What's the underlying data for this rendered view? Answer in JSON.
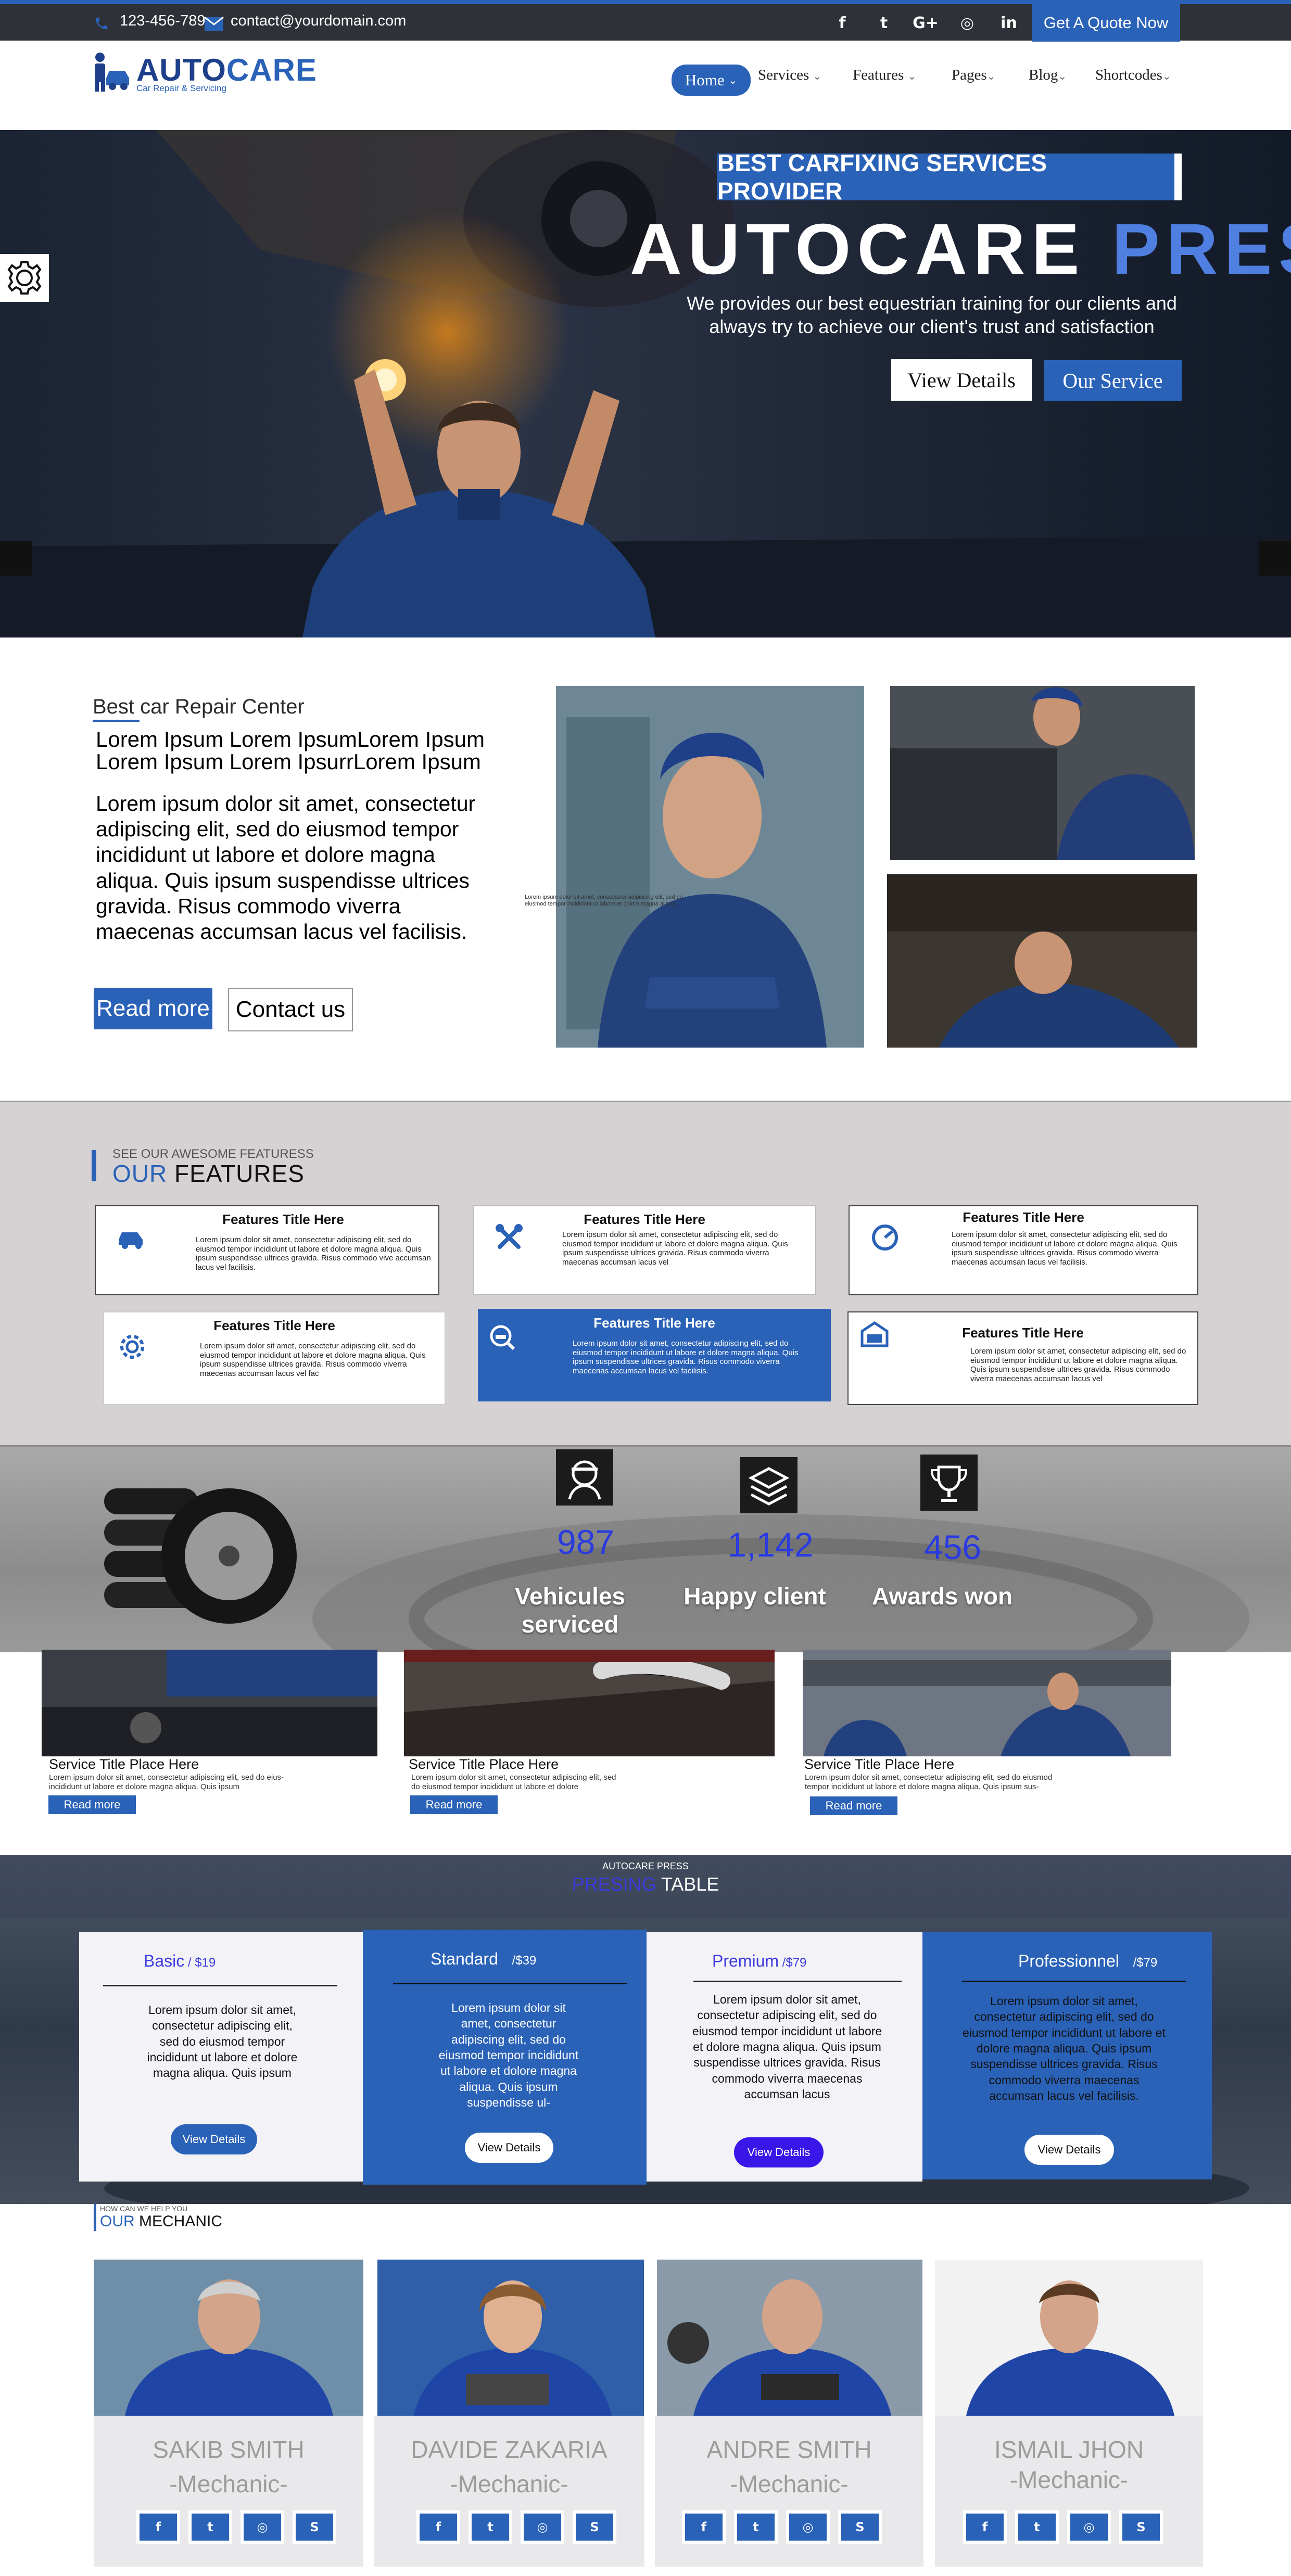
{
  "topbar": {
    "phone": "123-456-789",
    "email": "contact@yourdomain.com",
    "social": [
      "f",
      "t",
      "G+",
      "◎",
      "in"
    ],
    "quote_button": "Get  A Quote Now"
  },
  "header": {
    "logo_auto": "AUTO",
    "logo_care": "CARE",
    "logo_tagline": "Car Repair & Servicing",
    "nav": [
      {
        "label": "Home",
        "active": true
      },
      {
        "label": "Services"
      },
      {
        "label": "Features"
      },
      {
        "label": "Pages"
      },
      {
        "label": "Blog"
      },
      {
        "label": "Shortcodes"
      }
    ]
  },
  "hero": {
    "badge": "BEST CARFIXING SERVICES PROVIDER",
    "title_main": "AUTOCARE ",
    "title_accent": "PRESS",
    "description": "We provides our best equestrian training for our clients and always try to achieve our client's trust and satisfaction",
    "view_button": "View Details",
    "service_button": "Our Service"
  },
  "about": {
    "eyebrow": "Best car Repair Center",
    "heading": "Lorem Ipsum Lorem IpsumLorem Ipsum Lorem Ipsum Lorem IpsurrLorem Ipsum",
    "body": "Lorem ipsum dolor sit amet, consectetur adipiscing elit, sed do eiusmod tempor incididunt ut labore et dolore magna aliqua. Quis ipsum suspendisse ultrices gravida. Risus commodo viverra maecenas accumsan lacus vel facilisis.",
    "read_more": "Read more",
    "contact": "Contact us",
    "small_text": "Lorem ipsum dolor sit amet, consectetur adipiscing elit, sed do eiusmod tempor incididunt ut labore et dolore magna aliqua."
  },
  "features": {
    "eyebrow": "SEE OUR AWESOME FEATURESS",
    "title_accent": "OUR",
    "title_rest": " FEATURES",
    "cards": [
      {
        "title": "Features Title Here",
        "text": "Lorem ipsum dolor sit amet, consectetur adipiscing elit, sed do eiusmod tempor incididunt ut labore et dolore magna aliqua. Quis ipsum suspendisse ultrices gravida. Risus commodo vive accumsan lacus vel facilisis.",
        "icon": "car-icon"
      },
      {
        "title": "Features Title Here",
        "text": "Lorem ipsum dolor sit amet, consectetur adipiscing elit, sed do eiusmod tempor incididunt ut labore et dolore magna aliqua. Quis ipsum suspendisse ultrices gravida. Risus commodo viverra maecenas accumsan lacus vel",
        "icon": "tools-icon"
      },
      {
        "title": "Features Title Here",
        "text": "Lorem ipsum dolor sit amet, consectetur adipiscing elit, sed do eiusmod tempor incididunt ut labore et dolore magna aliqua. Quis ipsum suspendisse ultrices gravida. Risus commodo viverra maecenas accumsan lacus vel facilisis.",
        "icon": "gauge-icon"
      },
      {
        "title": "Features Title Here",
        "text": "Lorem ipsum dolor sit amet, consectetur adipiscing elit, sed do eiusmod tempor incididunt ut labore et dolore magna aliqua. Quis ipsum suspendisse ultrices gravida. Risus commodo viverra maecenas accumsan lacus vel fac",
        "icon": "gear-icon"
      },
      {
        "title": "Features Title Here",
        "text": "Lorem ipsum dolor sit amet, consectetur adipiscing elit, sed do eiusmod tempor incididunt ut labore et dolore magna aliqua. Quis ipsum suspendisse ultrices gravida. Risus commodo viverra maecenas accumsan lacus vel facilisis.",
        "icon": "search-car-icon",
        "active": true
      },
      {
        "title": "Features Title Here",
        "text": "Lorem ipsum dolor sit amet, consectetur adipiscing elit, sed do eiusmod tempor incididunt ut labore et dolore magna aliqua. Quis ipsum suspendisse ultrices gravida. Risus commodo viverra maecenas accumsan lacus vel",
        "icon": "garage-icon"
      }
    ]
  },
  "stats": [
    {
      "number": "987",
      "label": "Vehicules serviced",
      "icon": "mechanic-icon"
    },
    {
      "number": "1,142",
      "label": "Happy client",
      "icon": "layers-icon"
    },
    {
      "number": "456",
      "label": "Awards won",
      "icon": "trophy-icon"
    }
  ],
  "services": [
    {
      "title": "Service Title Place Here",
      "text": "Lorem ipsum dolor sit amet, consectetur adipiscing elit, sed do eius- incididunt ut labore et dolore magna aliqua. Quis ipsum",
      "button": "Read more"
    },
    {
      "title": "Service Title Place Here",
      "text": "Lorem ipsum dolor sit amet, consectetur adipiscing elit, sed do eiusmod tempor incididunt ut labore et dolore",
      "button": "Read more"
    },
    {
      "title": "Service Title Place Here",
      "text": "Lorem ipsum dolor sit amet, consectetur adipiscing elit, sed do eiusmod tempor incididunt ut labore et dolore magna aliqua. Quis ipsum sus-",
      "button": "Read more"
    }
  ],
  "pricing": {
    "eyebrow": "AUTOCARE PRESS",
    "title_accent": "PRESING",
    "title_rest": " TABLE",
    "plans": [
      {
        "name": "Basic",
        "price": " / $19",
        "text": "Lorem ipsum dolor sit amet, consectetur adipiscing elit, sed do eiusmod tempor incididunt ut labore et dolore magna aliqua. Quis ipsum",
        "button": "View Details"
      },
      {
        "name": "Standard",
        "price": "    /$39",
        "text": "Lorem ipsum dolor sit amet, consectetur adipiscing elit, sed do eiusmod tempor incididunt ut labore et dolore magna aliqua. Quis ipsum suspendisse ul-",
        "button": "View Details"
      },
      {
        "name": "Premium",
        "price": " /$79",
        "text": "Lorem ipsum dolor sit amet, consectetur adipiscing elit, sed do eiusmod tempor incididunt ut labore et dolore magna aliqua. Quis ipsum suspendisse ultrices gravida. Risus commodo viverra maecenas accumsan lacus",
        "button": "View Details"
      },
      {
        "name": "Professionnel",
        "price": "    /$79",
        "text": "Lorem ipsum dolor sit amet, consectetur adipiscing elit, sed do eiusmod tempor incididunt ut labore et dolore magna aliqua. Quis ipsum suspendisse ultrices gravida. Risus commodo viverra maecenas accumsan lacus vel facilisis.",
        "button": "View Details"
      }
    ]
  },
  "mechanics": {
    "eyebrow": "HOW CAN WE HELP YOU",
    "title_accent": "OUR",
    "title_rest": " MECHANIC",
    "people": [
      {
        "name": "SAKIB SMITH",
        "role": "-Mechanic-"
      },
      {
        "name": "DAVIDE ZAKARIA",
        "role": "-Mechanic-"
      },
      {
        "name": "ANDRE SMITH",
        "role": "-Mechanic-"
      },
      {
        "name": "ISMAIL JHON",
        "role": "-Mechanic-"
      }
    ],
    "social": [
      "f",
      "t",
      "◎",
      "S"
    ]
  },
  "colors": {
    "brand_blue": "#2a62b8",
    "topbar": "#2f3138",
    "number_blue": "#2a3be0",
    "features_bg": "#d6d2d4"
  }
}
